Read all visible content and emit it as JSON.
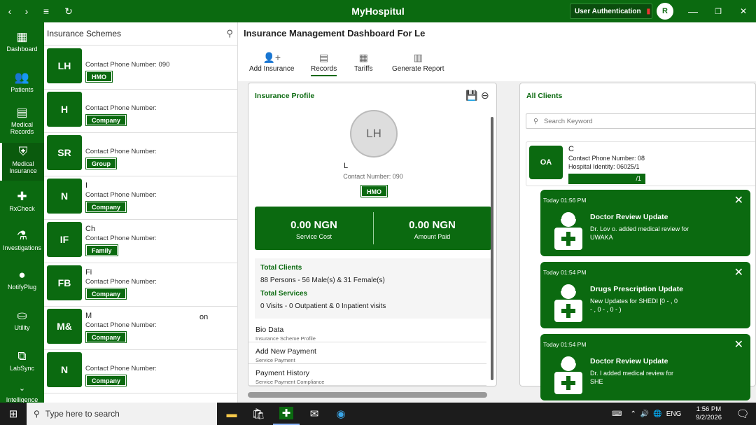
{
  "window": {
    "title": "MyHospitul",
    "user_auth_label": "User Authentication",
    "avatar_initial": "R",
    "controls": {
      "minimize": "—",
      "maximize": "❐",
      "close": "✕"
    }
  },
  "nav": {
    "items": [
      {
        "label": "Dashboard",
        "icon": "dashboard-icon"
      },
      {
        "label": "Patients",
        "icon": "patients-icon"
      },
      {
        "label": "Medical Records",
        "icon": "records-icon"
      },
      {
        "label": "Medical Insurance",
        "icon": "insurance-icon"
      },
      {
        "label": "RxCheck",
        "icon": "rxcheck-icon"
      },
      {
        "label": "Investigations",
        "icon": "investigations-icon"
      },
      {
        "label": "NotifyPlug",
        "icon": "notify-icon"
      },
      {
        "label": "Utility",
        "icon": "utility-icon"
      },
      {
        "label": "LabSync",
        "icon": "labsync-icon"
      },
      {
        "label": "Intelligence",
        "icon": "intelligence-icon"
      }
    ]
  },
  "schemes": {
    "heading": "Insurance Schemes",
    "items": [
      {
        "initials": "LH",
        "name": "",
        "phone": "Contact Phone Number: 090",
        "tag": "HMO"
      },
      {
        "initials": "H",
        "name": "",
        "phone": "Contact Phone Number:",
        "tag": "Company"
      },
      {
        "initials": "SR",
        "name": "",
        "phone": "Contact Phone Number:",
        "tag": "Group"
      },
      {
        "initials": "N",
        "name": "I",
        "phone": "Contact Phone Number:",
        "tag": "Company"
      },
      {
        "initials": "IF",
        "name": "Ch",
        "phone": "Contact Phone Number:",
        "tag": "Family"
      },
      {
        "initials": "FB",
        "name": "Fi",
        "phone": "Contact Phone Number:",
        "tag": "Company"
      },
      {
        "initials": "M&",
        "name": "M",
        "phone": "Contact Phone Number:",
        "tag": "Company"
      },
      {
        "initials": "N",
        "name": "",
        "phone": "Contact Phone Number:",
        "tag": "Company"
      }
    ],
    "extra_text": "on"
  },
  "main": {
    "title": "Insurance Management Dashboard For Le",
    "toolbar": [
      {
        "label": "Add Insurance",
        "icon": "add-user-icon"
      },
      {
        "label": "Records",
        "icon": "records-icon"
      },
      {
        "label": "Tariffs",
        "icon": "table-icon"
      },
      {
        "label": "Generate Report",
        "icon": "report-icon"
      }
    ]
  },
  "profile": {
    "title": "Insurance Profile",
    "initials": "LH",
    "name": "L",
    "contact": "Contact Number: 090",
    "tag": "HMO",
    "service_cost": "0.00 NGN",
    "service_cost_label": "Service Cost",
    "amount_paid": "0.00 NGN",
    "amount_paid_label": "Amount Paid",
    "total_clients_label": "Total Clients",
    "total_clients_value": "88 Persons - 56 Male(s) & 31 Female(s)",
    "total_services_label": "Total Services",
    "total_services_value": "0 Visits - 0 Outpatient & 0 Inpatient visits",
    "sections": [
      {
        "title": "Bio Data",
        "sub": "Insurance Scheme Profile"
      },
      {
        "title": "Add New Payment",
        "sub": "Service Payment"
      },
      {
        "title": "Payment History",
        "sub": "Service Payment Compliance"
      }
    ]
  },
  "clients": {
    "title": "All Clients",
    "search_placeholder": "Search Keyword",
    "card": {
      "initials": "OA",
      "name": "C",
      "phone": "Contact Phone Number: 08",
      "hospital_id": "Hospital Identity: 06025/1",
      "tag": "/1"
    }
  },
  "notifications": [
    {
      "time": "Today 01:56 PM",
      "title": "Doctor Review Update",
      "body1": "Dr. Lov            o. added medical review for",
      "body2": "UWAKA"
    },
    {
      "time": "Today 01:54 PM",
      "title": "Drugs Prescription Update",
      "body1": "New Updates for SHEDI                              [0 - , 0",
      "body2": "- , 0 - , 0 - )"
    },
    {
      "time": "Today 01:54 PM",
      "title": "Doctor Review Update",
      "body1": "Dr. I                         added medical review for",
      "body2": "SHE"
    }
  ],
  "taskbar": {
    "search_placeholder": "Type here to search",
    "lang": "ENG",
    "time": "1:56 PM",
    "date": "9/2/2026"
  }
}
